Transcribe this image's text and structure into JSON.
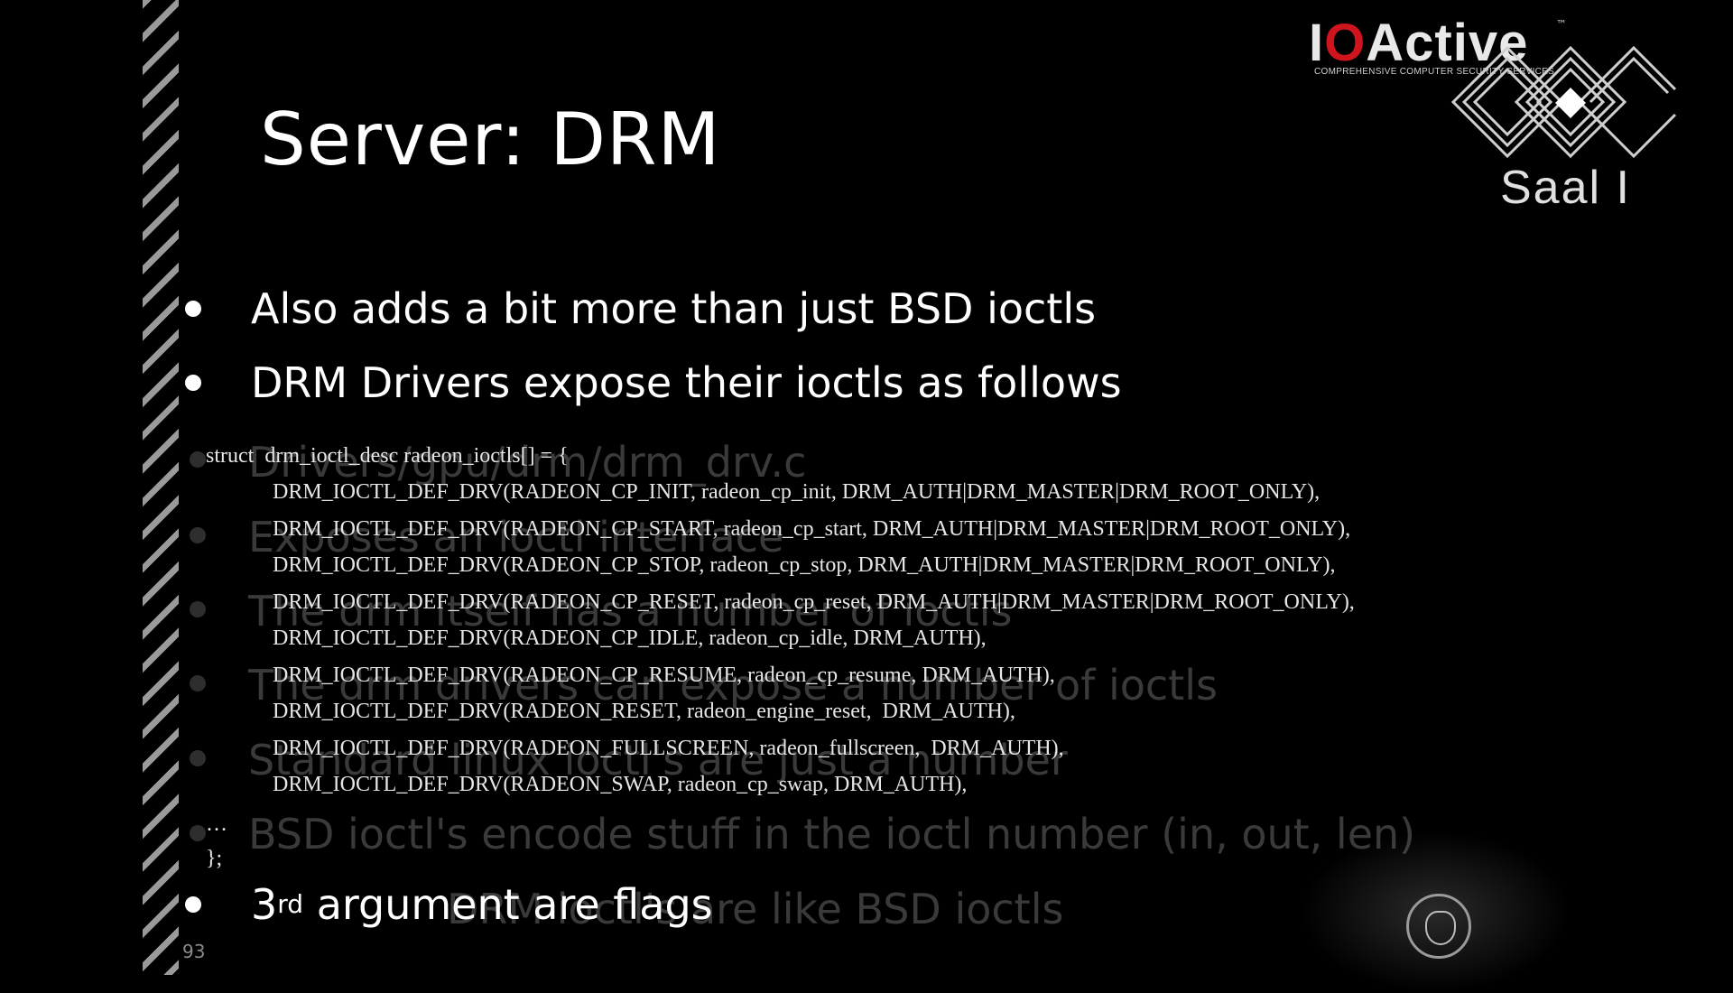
{
  "slide": {
    "title": "Server: DRM",
    "page_number": "93"
  },
  "logo": {
    "brand_io": "I",
    "brand_o": "O",
    "brand_active": "Active",
    "trademark": "™",
    "tagline": "COMPREHENSIVE COMPUTER SECURITY SERVICES",
    "venue": "Saal I"
  },
  "bullets": [
    "Also adds a bit more than just BSD ioctls",
    "DRM Drivers expose their ioctls as follows",
    "argument are flags"
  ],
  "bullet3_prefix": "3",
  "bullet3_sup": "rd",
  "ghost_text": [
    "Drivers/gpu/drm/drm_drv.c",
    "Exposes an ioctl interface",
    "The drm itself has a number of ioctls",
    "The drm drivers can expose a number of ioctls",
    "Standard linux ioctl's are just a number",
    "BSD ioctl's encode stuff in the ioctl number (in, out, len)",
    "DRM ioctl's are like BSD ioctls"
  ],
  "code": {
    "open": "struct  drm_ioctl_desc radeon_ioctls[] = {",
    "lines": [
      "DRM_IOCTL_DEF_DRV(RADEON_CP_INIT, radeon_cp_init, DRM_AUTH|DRM_MASTER|DRM_ROOT_ONLY),",
      "DRM_IOCTL_DEF_DRV(RADEON_CP_START, radeon_cp_start, DRM_AUTH|DRM_MASTER|DRM_ROOT_ONLY),",
      "DRM_IOCTL_DEF_DRV(RADEON_CP_STOP, radeon_cp_stop, DRM_AUTH|DRM_MASTER|DRM_ROOT_ONLY),",
      "DRM_IOCTL_DEF_DRV(RADEON_CP_RESET, radeon_cp_reset, DRM_AUTH|DRM_MASTER|DRM_ROOT_ONLY),",
      "DRM_IOCTL_DEF_DRV(RADEON_CP_IDLE, radeon_cp_idle, DRM_AUTH),",
      "DRM_IOCTL_DEF_DRV(RADEON_CP_RESUME, radeon_cp_resume, DRM_AUTH),",
      "DRM_IOCTL_DEF_DRV(RADEON_RESET, radeon_engine_reset,  DRM_AUTH),",
      "DRM_IOCTL_DEF_DRV(RADEON_FULLSCREEN, radeon_fullscreen,  DRM_AUTH),",
      "DRM_IOCTL_DEF_DRV(RADEON_SWAP, radeon_cp_swap, DRM_AUTH),"
    ],
    "ellipsis": "…",
    "close": "};"
  }
}
